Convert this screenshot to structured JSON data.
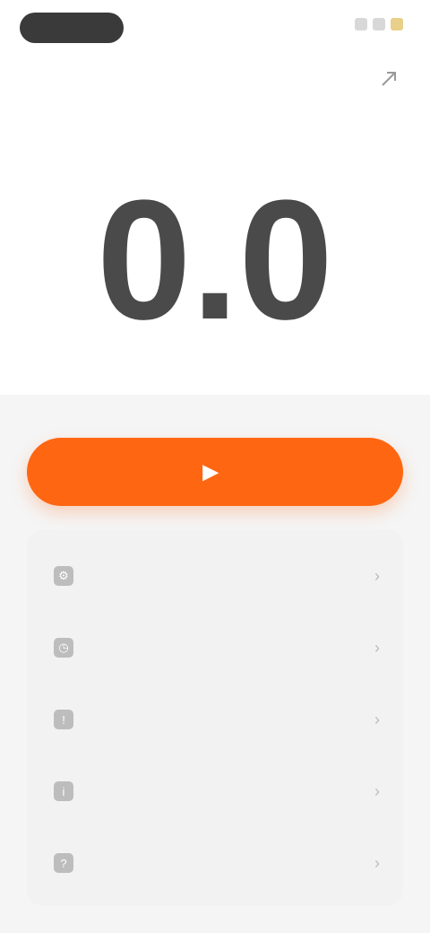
{
  "status_bar": {
    "icons": [
      "time-pill",
      "signal-icon",
      "wifi-icon",
      "battery-icon"
    ]
  },
  "header": {
    "title": "",
    "action_icon": "share-icon"
  },
  "speedometer": {
    "value": "0.0",
    "unit": ""
  },
  "hint": "",
  "start_button": {
    "label": "",
    "icon": "play-icon",
    "color": "#ff6612"
  },
  "settings": {
    "items": [
      {
        "icon": "settings-icon",
        "label": "",
        "value": ""
      },
      {
        "icon": "speed-icon",
        "label": "",
        "value": ""
      },
      {
        "icon": "alert-icon",
        "label": "",
        "value": ""
      },
      {
        "icon": "info-icon",
        "label": "",
        "value": ""
      },
      {
        "icon": "help-icon",
        "label": "",
        "sub": "",
        "value": ""
      }
    ]
  },
  "colors": {
    "accent": "#ff6612",
    "background": "#f5f5f5",
    "card": "#f2f2f2",
    "text": "#4a4a4a"
  }
}
